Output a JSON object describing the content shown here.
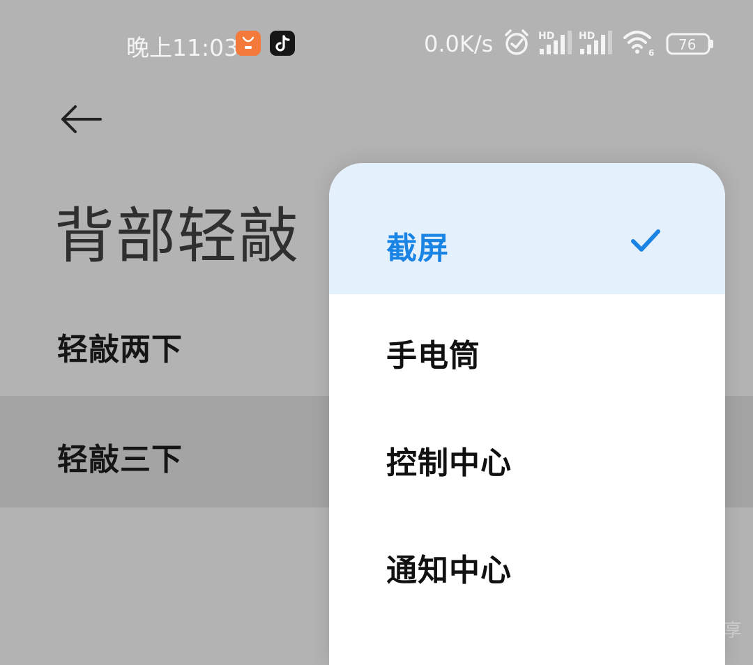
{
  "status_bar": {
    "time": "晚上11:03",
    "net_speed": "0.0K/s",
    "signal_1_label": "HD",
    "signal_2_label": "HD",
    "wifi_badge": "6",
    "battery_level": "76",
    "app_icons": [
      "mi-store-icon",
      "tiktok-icon"
    ]
  },
  "page": {
    "title": "背部轻敲",
    "rows": [
      {
        "label": "轻敲两下"
      },
      {
        "label": "轻敲三下"
      }
    ]
  },
  "dropdown": {
    "options": [
      {
        "label": "截屏",
        "selected": true
      },
      {
        "label": "手电筒",
        "selected": false
      },
      {
        "label": "控制中心",
        "selected": false
      },
      {
        "label": "通知中心",
        "selected": false
      }
    ]
  },
  "watermark": "享",
  "colors": {
    "accent": "#1a84e5",
    "selected_bg": "#e5f0fd",
    "dim_background": "#b3b3b3",
    "highlight_row": "#a4a4a4",
    "mi_store": "#f37a3a",
    "tiktok": "#161617"
  }
}
